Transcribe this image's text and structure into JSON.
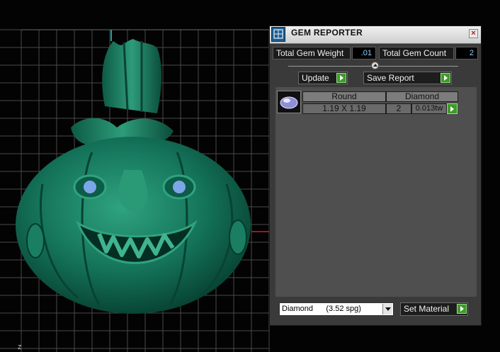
{
  "viewport": {
    "axis_label": "Z"
  },
  "panel": {
    "title": "GEM REPORTER",
    "total_weight_label": "Total Gem Weight",
    "total_weight_value": ".01",
    "total_count_label": "Total Gem Count",
    "total_count_value": "2",
    "update_label": "Update",
    "save_report_label": "Save Report",
    "table": {
      "headers": [
        "Round",
        "Diamond"
      ],
      "row": {
        "size": "1.19 X 1.19",
        "count": "2",
        "weight": "0.013tw"
      }
    },
    "material_value": "Diamond      (3.52 spg)",
    "set_material_label": "Set Material"
  },
  "colors": {
    "model_green": "#14735a",
    "eye_blue": "#7ba6e8",
    "button_arrow_green": "#3f9b2a",
    "value_text": "#8fd0ff"
  }
}
